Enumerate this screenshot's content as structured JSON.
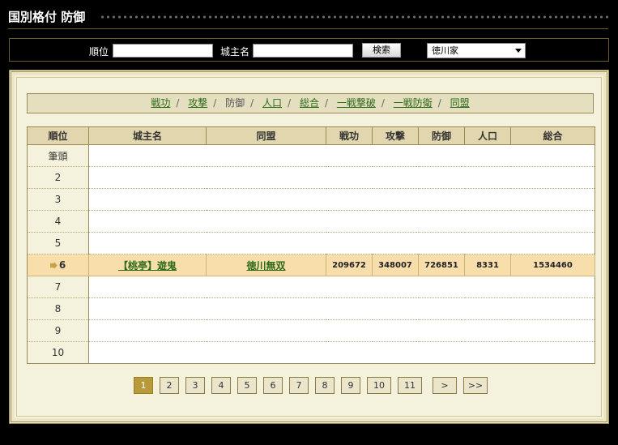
{
  "header": {
    "title": "国別格付 防御"
  },
  "search": {
    "rank_label": "順位",
    "name_label": "城主名",
    "rank_value": "",
    "name_value": "",
    "search_button": "検索",
    "country_select": "徳川家"
  },
  "tabs": [
    {
      "label": "戦功",
      "current": false
    },
    {
      "label": "攻撃",
      "current": false
    },
    {
      "label": "防御",
      "current": true
    },
    {
      "label": "人口",
      "current": false
    },
    {
      "label": "総合",
      "current": false
    },
    {
      "label": "一戦撃破",
      "current": false
    },
    {
      "label": "一戦防衛",
      "current": false
    },
    {
      "label": "同盟",
      "current": false
    }
  ],
  "table": {
    "headers": [
      "順位",
      "城主名",
      "同盟",
      "戦功",
      "攻撃",
      "防御",
      "人口",
      "総合"
    ],
    "rows": [
      {
        "rank": "筆頭"
      },
      {
        "rank": "2"
      },
      {
        "rank": "3"
      },
      {
        "rank": "4"
      },
      {
        "rank": "5"
      },
      {
        "rank": "6",
        "highlight": true,
        "name": "【桃亭】遊鬼",
        "alliance": "徳川無双",
        "senko": "209672",
        "attack": "348007",
        "defense": "726851",
        "population": "8331",
        "total": "1534460"
      },
      {
        "rank": "7"
      },
      {
        "rank": "8"
      },
      {
        "rank": "9"
      },
      {
        "rank": "10"
      }
    ]
  },
  "pager": {
    "pages": [
      "1",
      "2",
      "3",
      "4",
      "5",
      "6",
      "7",
      "8",
      "9",
      "10",
      "11"
    ],
    "current": "1",
    "next": ">",
    "last": ">>"
  },
  "colors": {
    "accent": "#b89a3a",
    "highlight_row": "#f7deab",
    "link": "#2d6a1a"
  }
}
